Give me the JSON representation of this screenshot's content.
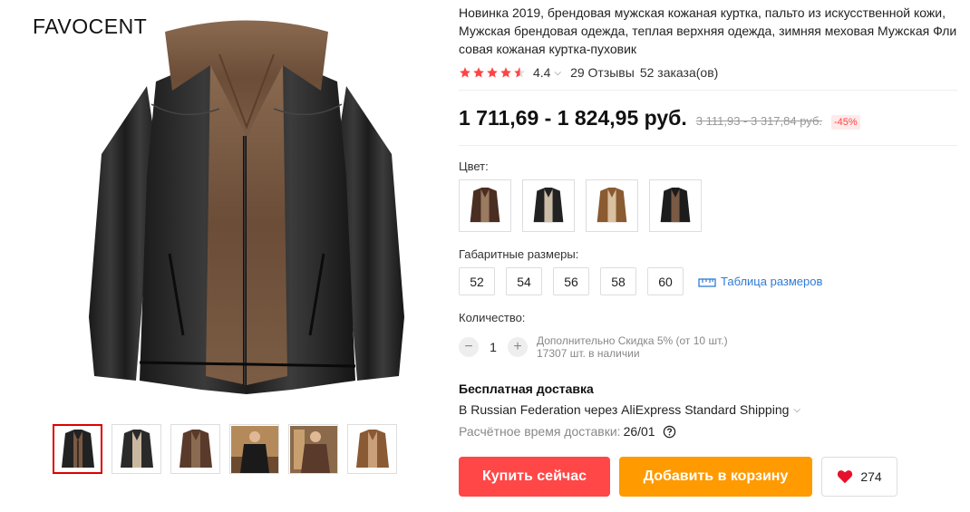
{
  "brand": "FAVOCENT",
  "product": {
    "title": "Новинка 2019, брендовая мужская кожаная куртка, пальто из искусственной кожи, Мужская брендовая одежда, теплая верхняя одежда, зимняя меховая Мужская Флисовая кожаная куртка-пуховик",
    "rating": "4.4",
    "reviews": "29 Отзывы",
    "orders": "52 заказа(ов)",
    "price": "1 711,69 - 1 824,95 руб.",
    "old_price": "3 111,93 - 3 317,84 руб.",
    "discount": "-45%"
  },
  "colors": {
    "star": "#f44",
    "buy": "#ff4747",
    "cart": "#ff9a00",
    "link": "#2e7bd6"
  },
  "options": {
    "color_label": "Цвет:",
    "color_variants": [
      "dark-brown",
      "black-beige",
      "camel",
      "black-brown"
    ],
    "size_label": "Габаритные размеры:",
    "sizes": [
      "52",
      "54",
      "56",
      "58",
      "60"
    ],
    "size_table": "Таблица размеров"
  },
  "quantity": {
    "label": "Количество:",
    "value": "1",
    "discount_note": "Дополнительно Скидка 5% (от 10 шт.)",
    "stock": "17307 шт. в наличии"
  },
  "shipping": {
    "title": "Бесплатная доставка",
    "method": "В Russian Federation через AliExpress Standard Shipping",
    "delivery_label": "Расчётное время доставки:",
    "delivery_date": "26/01"
  },
  "actions": {
    "buy": "Купить сейчас",
    "cart": "Добавить в корзину",
    "wishlist_count": "274"
  },
  "gallery": {
    "thumb_count": 6,
    "active_index": 0
  }
}
